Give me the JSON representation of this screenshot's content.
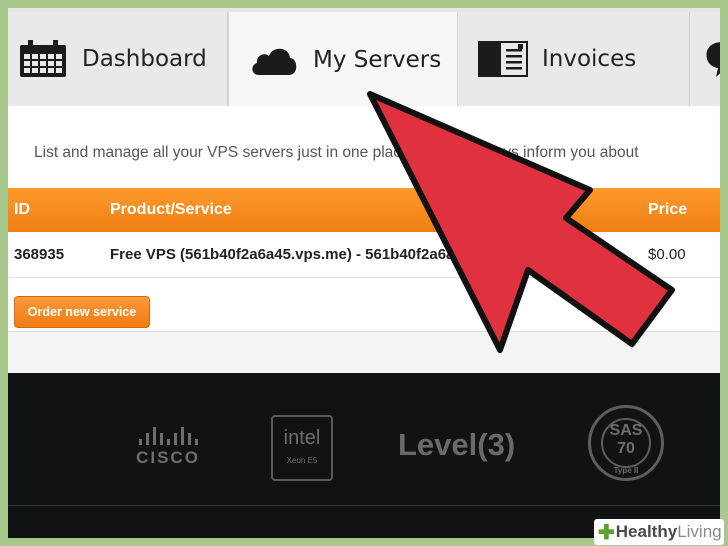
{
  "tabs": [
    {
      "label": "Dashboard",
      "icon": "calendar-icon"
    },
    {
      "label": "My Servers",
      "icon": "cloud-icon"
    },
    {
      "label": "Invoices",
      "icon": "invoice-icon"
    },
    {
      "label": "",
      "icon": "speech-bubble-icon"
    }
  ],
  "intro_text": "List and manage all your VPS servers just in one place. We will always inform you about",
  "table": {
    "columns": [
      "ID",
      "Product/Service",
      "Price"
    ],
    "rows": [
      {
        "id": "368935",
        "product": "Free VPS (561b40f2a6a45.vps.me) - 561b40f2a6a45",
        "price": "$0.00"
      }
    ]
  },
  "order_button_label": "Order new service",
  "partners": {
    "cisco": "CISCO",
    "intel": "intel",
    "intel_sub": "Xeon E5",
    "level3": "Level(3)",
    "sas_top": "SAS",
    "sas_num": "70",
    "sas_type": "Type II"
  },
  "watermark": {
    "prefix": "Healthy",
    "suffix": "Living"
  },
  "colors": {
    "accent_orange": "#f58a1f",
    "arrow_red": "#e0313f",
    "footer_bg": "#111214",
    "border_green": "#a8c88c"
  }
}
